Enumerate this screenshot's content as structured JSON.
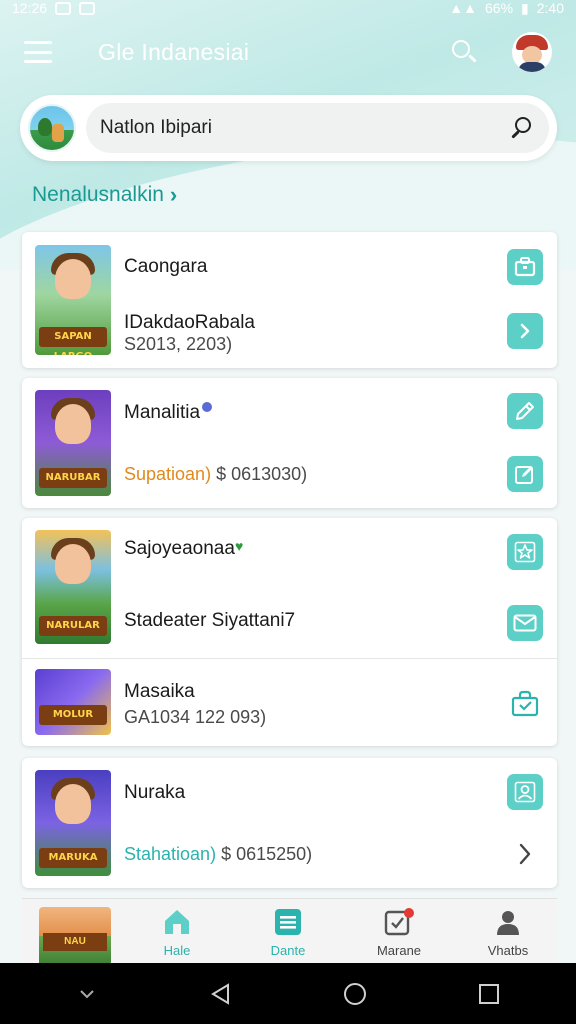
{
  "status_bar": {
    "time_left": "12:26",
    "battery_text": "66%",
    "time_right": "2:40"
  },
  "app_bar": {
    "title": "Gle Indanesiai",
    "menu_icon": "hamburger-menu-icon",
    "search_icon": "search-icon",
    "avatar_icon": "user-avatar"
  },
  "search": {
    "value": "Natlon Ibipari",
    "icon": "search-icon"
  },
  "section": {
    "title": "Nenalusnalkin",
    "chevron": "›"
  },
  "cards": [
    {
      "items": [
        {
          "title": "Caongara",
          "subtitle": "IDakdaoRabala",
          "meta": "S2013, 2203)",
          "thumb_label": "SAPAN LARGO",
          "actions": [
            {
              "icon": "briefcase-icon",
              "style": "filled"
            },
            {
              "icon": "chevron-right-icon",
              "style": "filled"
            }
          ]
        }
      ]
    },
    {
      "items": [
        {
          "title": "Manalitia",
          "meta_accent": "Supatioan)",
          "meta_rest": "$ 0613030)",
          "thumb_label": "NARUBAR",
          "actions": [
            {
              "icon": "edit-icon",
              "style": "filled"
            },
            {
              "icon": "edit-box-icon",
              "style": "filled"
            }
          ]
        }
      ]
    },
    {
      "items": [
        {
          "title": "Sajoyeaonaa",
          "subtitle": "Stadeater Siyattani7",
          "thumb_label": "NARULAR",
          "actions": [
            {
              "icon": "star-icon",
              "style": "filled"
            },
            {
              "icon": "mail-icon",
              "style": "filled"
            }
          ]
        },
        {
          "title": "Masaika",
          "meta": "GA1034 122 093)",
          "thumb_label": "MOLUR",
          "actions": [
            {
              "icon": "shopping-bag-icon",
              "style": "outline"
            }
          ]
        }
      ]
    },
    {
      "items": [
        {
          "title": "Nuraka",
          "meta_accent": "Stahatioan)",
          "meta_rest": "$ 0615250)",
          "thumb_label": "MARUKA",
          "actions": [
            {
              "icon": "person-icon",
              "style": "filled"
            },
            {
              "icon": "chevron-right-icon",
              "style": "plain"
            }
          ]
        }
      ]
    }
  ],
  "tab_bar": {
    "thumb_label": "NAU",
    "tabs": [
      {
        "label": "Hale",
        "icon": "home-icon",
        "active": true
      },
      {
        "label": "Dante",
        "icon": "list-icon",
        "active": true
      },
      {
        "label": "Marane",
        "icon": "notifications-icon",
        "active": false
      },
      {
        "label": "Vhatbs",
        "icon": "profile-icon",
        "active": false
      }
    ]
  },
  "colors": {
    "accent": "#5ccfc7",
    "accent_text": "#2bb3ad",
    "orange": "#e08a1e",
    "header_bg": "#bfe9e6"
  }
}
